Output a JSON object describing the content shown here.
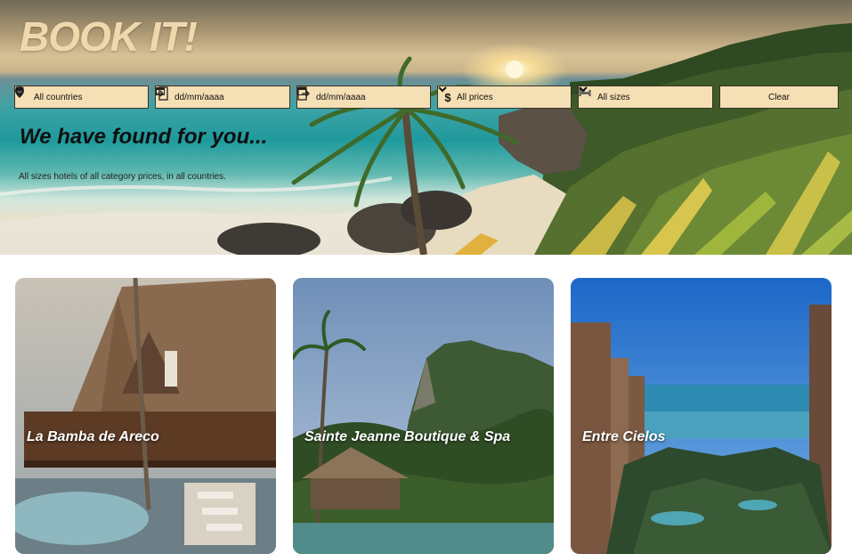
{
  "brand": {
    "logo": "BOOK IT!"
  },
  "filters": {
    "country": {
      "value": "All countries",
      "icon": "map-pin-icon"
    },
    "checkin": {
      "placeholder": "dd/mm/aaaa",
      "icon": "checkin-icon"
    },
    "checkout": {
      "placeholder": "dd/mm/aaaa",
      "icon": "checkout-icon"
    },
    "price": {
      "value": "All prices",
      "icon": "dollar-icon"
    },
    "size": {
      "value": "All sizes",
      "icon": "bed-icon"
    },
    "clear_label": "Clear"
  },
  "results": {
    "headline": "We have found for you...",
    "summary": "All sizes hotels of all category prices, in all countries."
  },
  "hotels": [
    {
      "name": "La Bamba de Areco"
    },
    {
      "name": "Sainte Jeanne Boutique & Spa"
    },
    {
      "name": "Entre Cielos"
    }
  ],
  "colors": {
    "filter_bg": "#f5dfb4",
    "logo": "#f0d8ad",
    "border": "#3a3326"
  }
}
